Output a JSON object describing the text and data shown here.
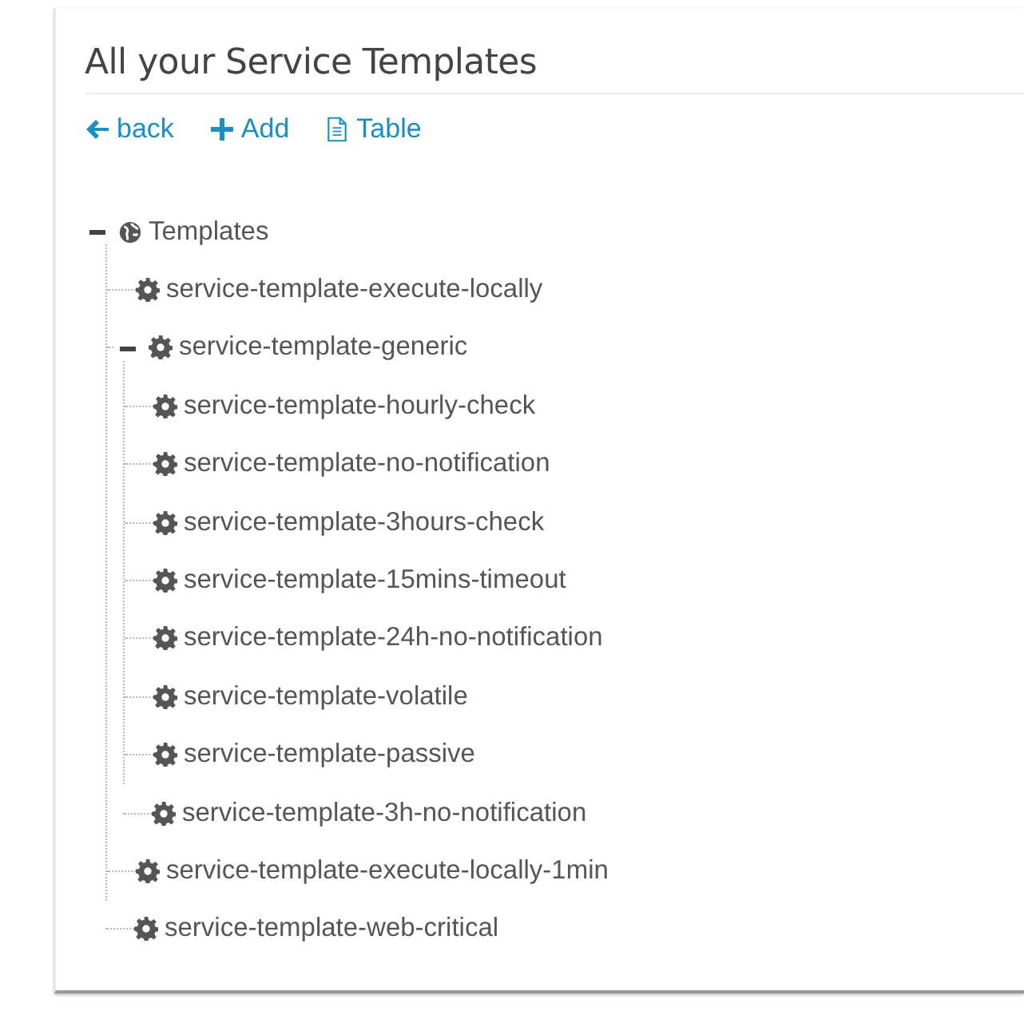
{
  "title": "All your Service Templates",
  "actions": [
    {
      "kind": "back",
      "label": "back"
    },
    {
      "kind": "add",
      "label": "Add"
    },
    {
      "kind": "table",
      "label": "Table"
    }
  ],
  "tree": [
    {
      "kind": "root",
      "label": "Templates",
      "expanded": true,
      "children": [
        {
          "kind": "template",
          "label": "service-template-execute-locally"
        },
        {
          "kind": "template",
          "label": "service-template-generic",
          "expanded": true,
          "children": [
            {
              "kind": "template",
              "label": "service-template-hourly-check"
            },
            {
              "kind": "template",
              "label": "service-template-no-notification"
            },
            {
              "kind": "template",
              "label": "service-template-3hours-check"
            },
            {
              "kind": "template",
              "label": "service-template-15mins-timeout"
            },
            {
              "kind": "template",
              "label": "service-template-24h-no-notification"
            },
            {
              "kind": "template",
              "label": "service-template-volatile"
            },
            {
              "kind": "template",
              "label": "service-template-passive"
            },
            {
              "kind": "template",
              "label": "service-template-3h-no-notification"
            }
          ]
        },
        {
          "kind": "template",
          "label": "service-template-execute-locally-1min"
        },
        {
          "kind": "template",
          "label": "service-template-web-critical"
        }
      ]
    }
  ]
}
